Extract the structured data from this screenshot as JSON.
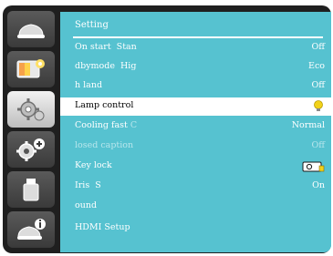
{
  "menu": {
    "title": "Setting",
    "rows": [
      {
        "label": "On start  Stan",
        "value": "Off"
      },
      {
        "label": "dbymode  Hig",
        "value": "Eco"
      },
      {
        "label": "h land",
        "value": "Off"
      },
      {
        "label": "Lamp control",
        "value": ""
      },
      {
        "label": "Cooling fast",
        "ghost": "C",
        "value": "Normal"
      },
      {
        "label": "losed caption",
        "value": "Off"
      },
      {
        "label": "Key lock",
        "value": ""
      },
      {
        "label": "Iris  S",
        "value": "On"
      },
      {
        "label": "ound",
        "value": ""
      },
      {
        "label": "HDMI Setup",
        "value": ""
      }
    ]
  },
  "icons": {
    "sidebar": [
      "display-icon",
      "picture-adjust-icon",
      "setting-gear-icon",
      "expanded-setting-gears-icon",
      "usb-memory-icon",
      "information-icon"
    ],
    "lamp": "lamp-bulb-icon",
    "keylock": "projector-lock-icon"
  },
  "colors": {
    "panel": "#56c2d0",
    "frame": "#1f1f1f",
    "selected_row": "#ffffff",
    "disabled_text": "#b8e6ec",
    "lamp_bulb": "#f2d21a"
  }
}
